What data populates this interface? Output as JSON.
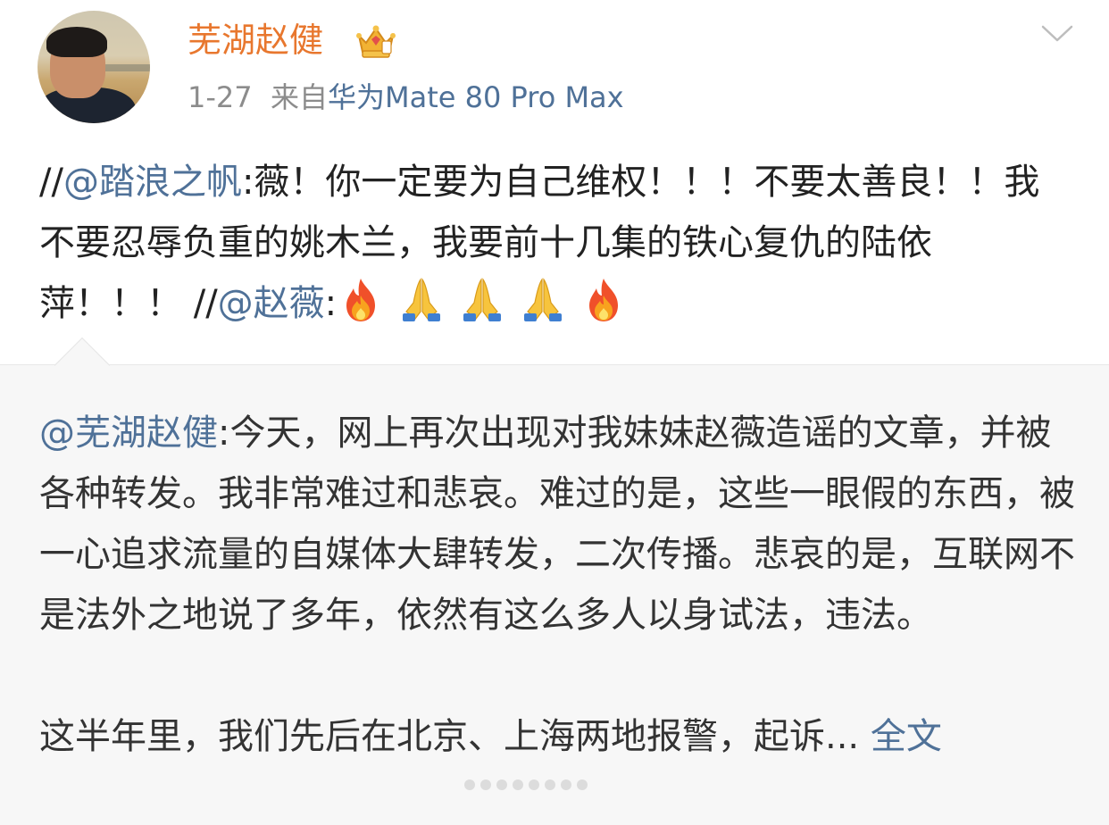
{
  "post": {
    "user": {
      "name": "芜湖赵健",
      "badge_icon": "vip-crown-icon"
    },
    "time": "1-27",
    "source_prefix": "来自",
    "device": "华为Mate 80 Pro Max",
    "text": {
      "prefix1": "//",
      "mention1": "@踏浪之帆",
      "body1": ":薇！你一定要为自己维权！！！不要太善良！！我不要忍辱负重的姚木兰，我要前十几集的铁心复仇的陆依萍！！！",
      "prefix2": "//",
      "mention2": "@赵薇",
      "body2": ":",
      "emojis": [
        "fire",
        "pray",
        "pray",
        "pray",
        "fire"
      ]
    }
  },
  "repost": {
    "mention": "@芜湖赵健",
    "paragraph1": ":今天，网上再次出现对我妹妹赵薇造谣的文章，并被各种转发。我非常难过和悲哀。难过的是，这些一眼假的东西，被一心追求流量的自媒体大肆转发，二次传播。悲哀的是，互联网不是法外之地说了多年，依然有这么多人以身试法，违法。",
    "paragraph2": "这半年里，我们先后在北京、上海两地报警，起诉...",
    "full_text_link": "全文"
  },
  "colors": {
    "username": "#e8772e",
    "link": "#4f7198",
    "meta": "#8c8c8c"
  }
}
